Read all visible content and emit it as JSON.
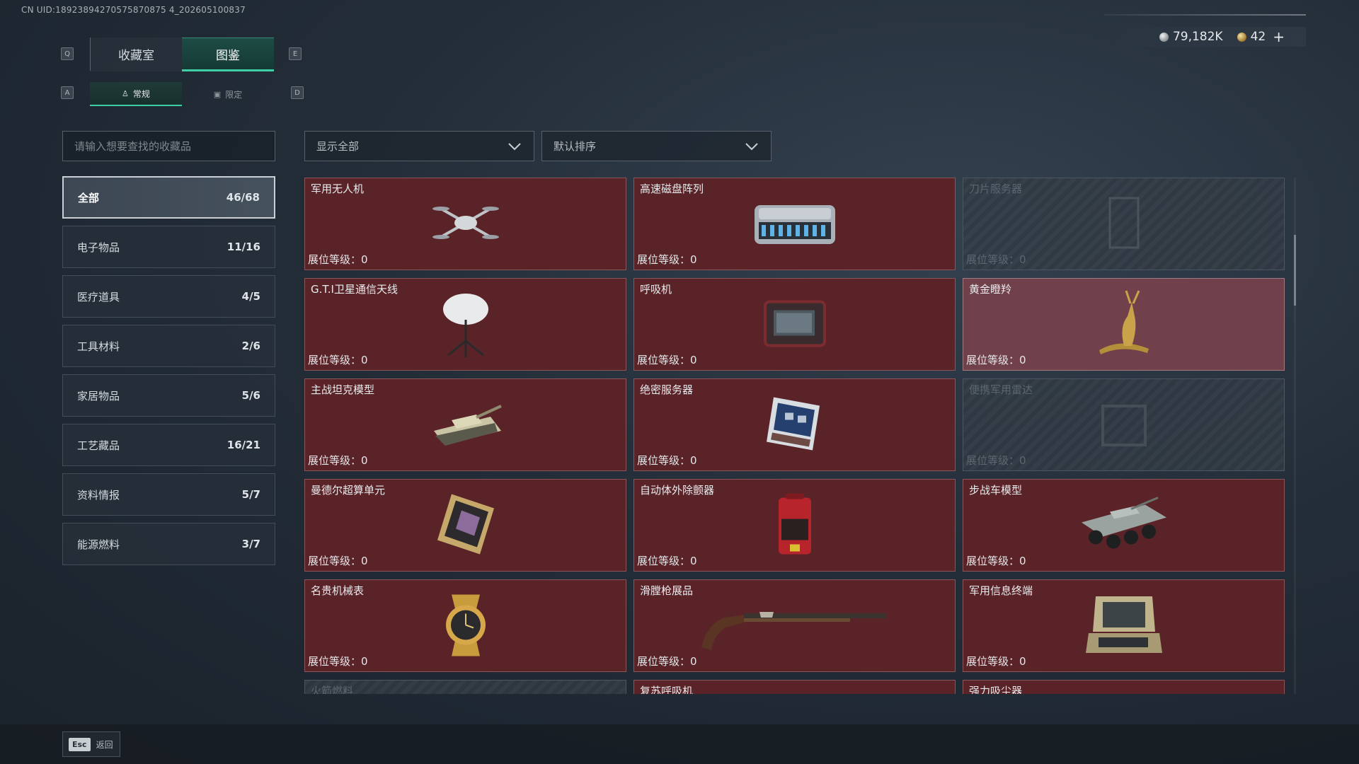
{
  "uid": "CN UID:18923894270575870875 4_202605100837",
  "currency": {
    "silver": "79,182K",
    "gold": "42",
    "add_symbol": "+"
  },
  "keys": {
    "tab_left": "Q",
    "tab_right": "E",
    "sub_left": "A",
    "sub_right": "D"
  },
  "tabs": [
    {
      "label": "收藏室",
      "active": false
    },
    {
      "label": "图鉴",
      "active": true
    }
  ],
  "subtabs": [
    {
      "label": "常规",
      "icon": "figure-icon",
      "active": true
    },
    {
      "label": "限定",
      "icon": "image-icon",
      "active": false
    }
  ],
  "search": {
    "placeholder": "请输入想要查找的收藏品",
    "value": ""
  },
  "filters": {
    "show": "显示全部",
    "sort": "默认排序"
  },
  "categories": [
    {
      "name": "全部",
      "count": "46/68",
      "active": true
    },
    {
      "name": "电子物品",
      "count": "11/16"
    },
    {
      "name": "医疗道具",
      "count": "4/5"
    },
    {
      "name": "工具材料",
      "count": "2/6"
    },
    {
      "name": "家居物品",
      "count": "5/6"
    },
    {
      "name": "工艺藏品",
      "count": "16/21"
    },
    {
      "name": "资料情报",
      "count": "5/7"
    },
    {
      "name": "能源燃料",
      "count": "3/7"
    }
  ],
  "level_label": "展位等级：",
  "items": [
    {
      "name": "军用无人机",
      "level": "0",
      "state": "owned",
      "icon": "drone-icon"
    },
    {
      "name": "高速磁盘阵列",
      "level": "0",
      "state": "owned",
      "icon": "disk-array-icon"
    },
    {
      "name": "刀片服务器",
      "level": "0",
      "state": "locked",
      "icon": "blade-server-icon"
    },
    {
      "name": "G.T.I卫星通信天线",
      "level": "0",
      "state": "owned",
      "icon": "satellite-dish-icon"
    },
    {
      "name": "呼吸机",
      "level": "0",
      "state": "owned",
      "icon": "ventilator-icon"
    },
    {
      "name": "黄金瞪羚",
      "level": "0",
      "state": "owned-light",
      "icon": "golden-gazelle-icon"
    },
    {
      "name": "主战坦克模型",
      "level": "0",
      "state": "owned",
      "icon": "tank-model-icon"
    },
    {
      "name": "绝密服务器",
      "level": "0",
      "state": "owned",
      "icon": "secret-server-icon"
    },
    {
      "name": "便携军用雷达",
      "level": "0",
      "state": "locked",
      "icon": "radar-icon"
    },
    {
      "name": "曼德尔超算单元",
      "level": "0",
      "state": "owned",
      "icon": "supercomputer-icon"
    },
    {
      "name": "自动体外除颤器",
      "level": "0",
      "state": "owned",
      "icon": "defibrillator-icon"
    },
    {
      "name": "步战车模型",
      "level": "0",
      "state": "owned",
      "icon": "ifv-model-icon"
    },
    {
      "name": "名贵机械表",
      "level": "0",
      "state": "owned",
      "icon": "watch-icon"
    },
    {
      "name": "滑膛枪展品",
      "level": "0",
      "state": "owned",
      "icon": "musket-icon"
    },
    {
      "name": "军用信息终端",
      "level": "0",
      "state": "owned",
      "icon": "terminal-icon"
    },
    {
      "name": "火箭燃料",
      "level": "",
      "state": "locked",
      "icon": "rocket-fuel-icon"
    },
    {
      "name": "复苏呼吸机",
      "level": "",
      "state": "owned",
      "icon": "resuscitator-icon"
    },
    {
      "name": "强力吸尘器",
      "level": "",
      "state": "owned",
      "icon": "vacuum-icon"
    }
  ],
  "footer": {
    "key": "Esc",
    "label": "返回"
  },
  "colors": {
    "accent": "#3fcfa6",
    "owned_card": "#5a2328",
    "owned_light_card": "#70414a",
    "locked_card": "#37404a"
  }
}
